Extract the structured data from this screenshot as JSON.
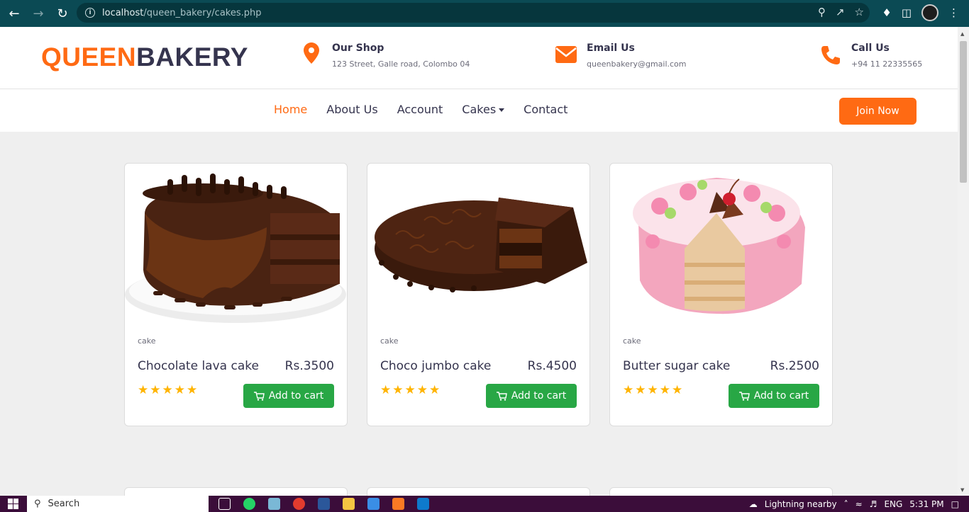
{
  "browser": {
    "url_host": "localhost",
    "url_path": "/queen_bakery/cakes.php"
  },
  "header": {
    "logo_part1": "QUEEN",
    "logo_part2": "BAKERY",
    "shop": {
      "title": "Our Shop",
      "text": "123 Street, Galle road, Colombo 04",
      "icon": "map-marker-icon"
    },
    "email": {
      "title": "Email Us",
      "text": "queenbakery@gmail.com",
      "icon": "envelope-icon"
    },
    "call": {
      "title": "Call Us",
      "text": "+94 11 22335565",
      "icon": "phone-icon"
    }
  },
  "nav": {
    "items": [
      {
        "label": "Home",
        "active": true
      },
      {
        "label": "About Us"
      },
      {
        "label": "Account"
      },
      {
        "label": "Cakes",
        "dropdown": true
      },
      {
        "label": "Contact"
      }
    ],
    "join_label": "Join Now"
  },
  "products": [
    {
      "category": "cake",
      "name": "Chocolate lava cake",
      "price": "Rs.3500",
      "rating": 5,
      "cart_label": "Add to cart"
    },
    {
      "category": "cake",
      "name": "Choco jumbo cake",
      "price": "Rs.4500",
      "rating": 5,
      "cart_label": "Add to cart"
    },
    {
      "category": "cake",
      "name": "Butter sugar cake",
      "price": "Rs.2500",
      "rating": 5,
      "cart_label": "Add to cart"
    }
  ],
  "taskbar": {
    "search_label": "Search",
    "weather_label": "Lightning nearby",
    "lang": "ENG",
    "time": "5:31 PM"
  },
  "colors": {
    "accent": "#ff6a13",
    "dark": "#35344e",
    "cart": "#28a745",
    "star": "#ffb400"
  }
}
